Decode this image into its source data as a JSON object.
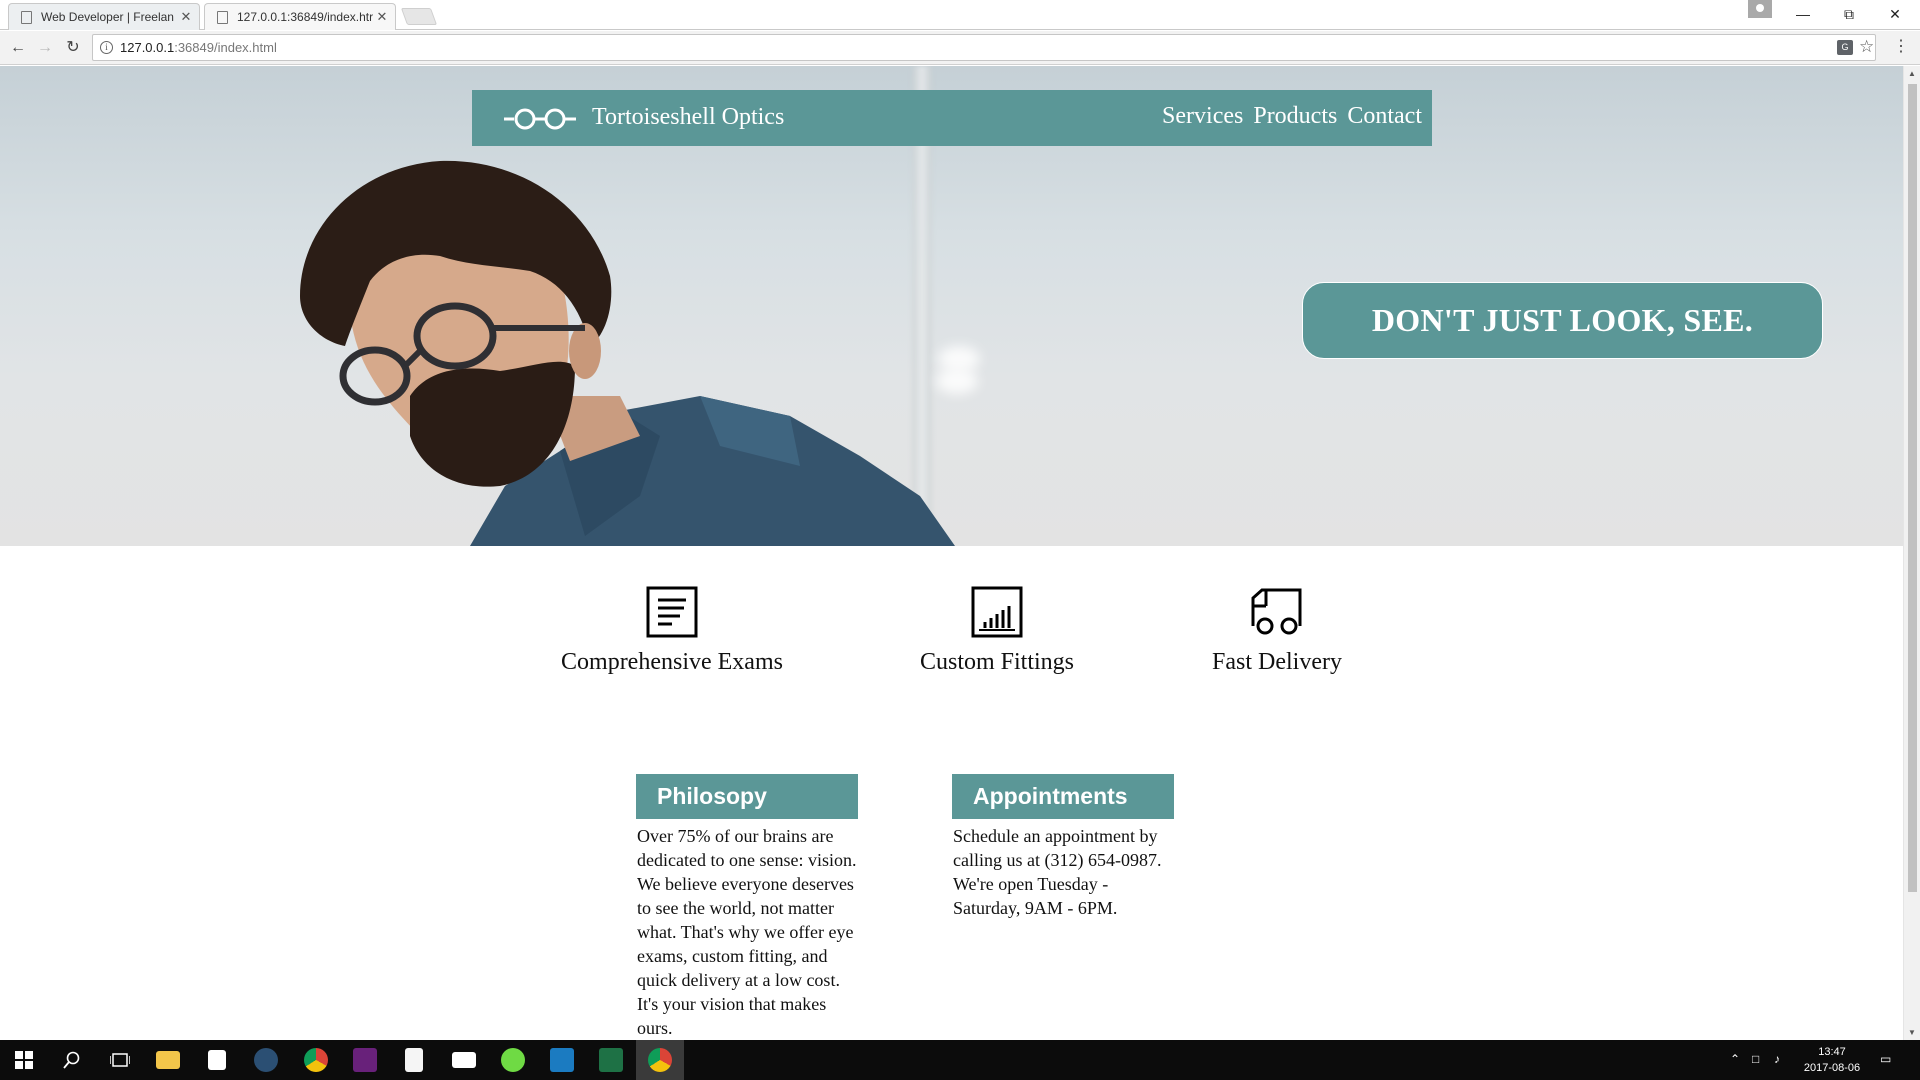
{
  "browser": {
    "tabs": [
      {
        "label": "Web Developer | Freelan",
        "close": "✕"
      },
      {
        "label": "127.0.0.1:36849/index.htr",
        "close": "✕"
      }
    ],
    "url_host": "127.0.0.1",
    "url_rest": ":36849/index.html",
    "icons": [
      "back-arrow",
      "forward-arrow",
      "reload",
      "info",
      "translate",
      "star",
      "menu"
    ]
  },
  "site": {
    "brand": "Tortoiseshell Optics",
    "nav": [
      "Services",
      "Products",
      "Contact"
    ],
    "tagline": "DON'T JUST LOOK, SEE.",
    "accent_color": "#5b9797",
    "features": [
      {
        "label": "Comprehensive Exams",
        "icon": "document-icon"
      },
      {
        "label": "Custom Fittings",
        "icon": "bar-chart-icon"
      },
      {
        "label": "Fast Delivery",
        "icon": "delivery-truck-icon"
      }
    ],
    "philosophy": {
      "title": "Philosopy",
      "text": "Over 75% of our brains are dedicated to one sense: vision. We believe everyone deserves to see the world, not matter what. That's why we offer eye exams, custom fitting, and quick delivery at a low cost. It's your vision that makes ours."
    },
    "appointments": {
      "title": "Appointments",
      "text": "Schedule an appointment by calling us at (312) 654-0987. We're open Tuesday - Saturday, 9AM - 6PM."
    }
  },
  "taskbar": {
    "time": "13:47",
    "date": "2017-08-06",
    "apps": [
      "windows-start",
      "search",
      "task-view",
      "file-explorer",
      "store",
      "steam",
      "chrome",
      "visual-studio",
      "notepad-plus",
      "mail",
      "upwork",
      "app-n",
      "excel",
      "chrome"
    ]
  }
}
